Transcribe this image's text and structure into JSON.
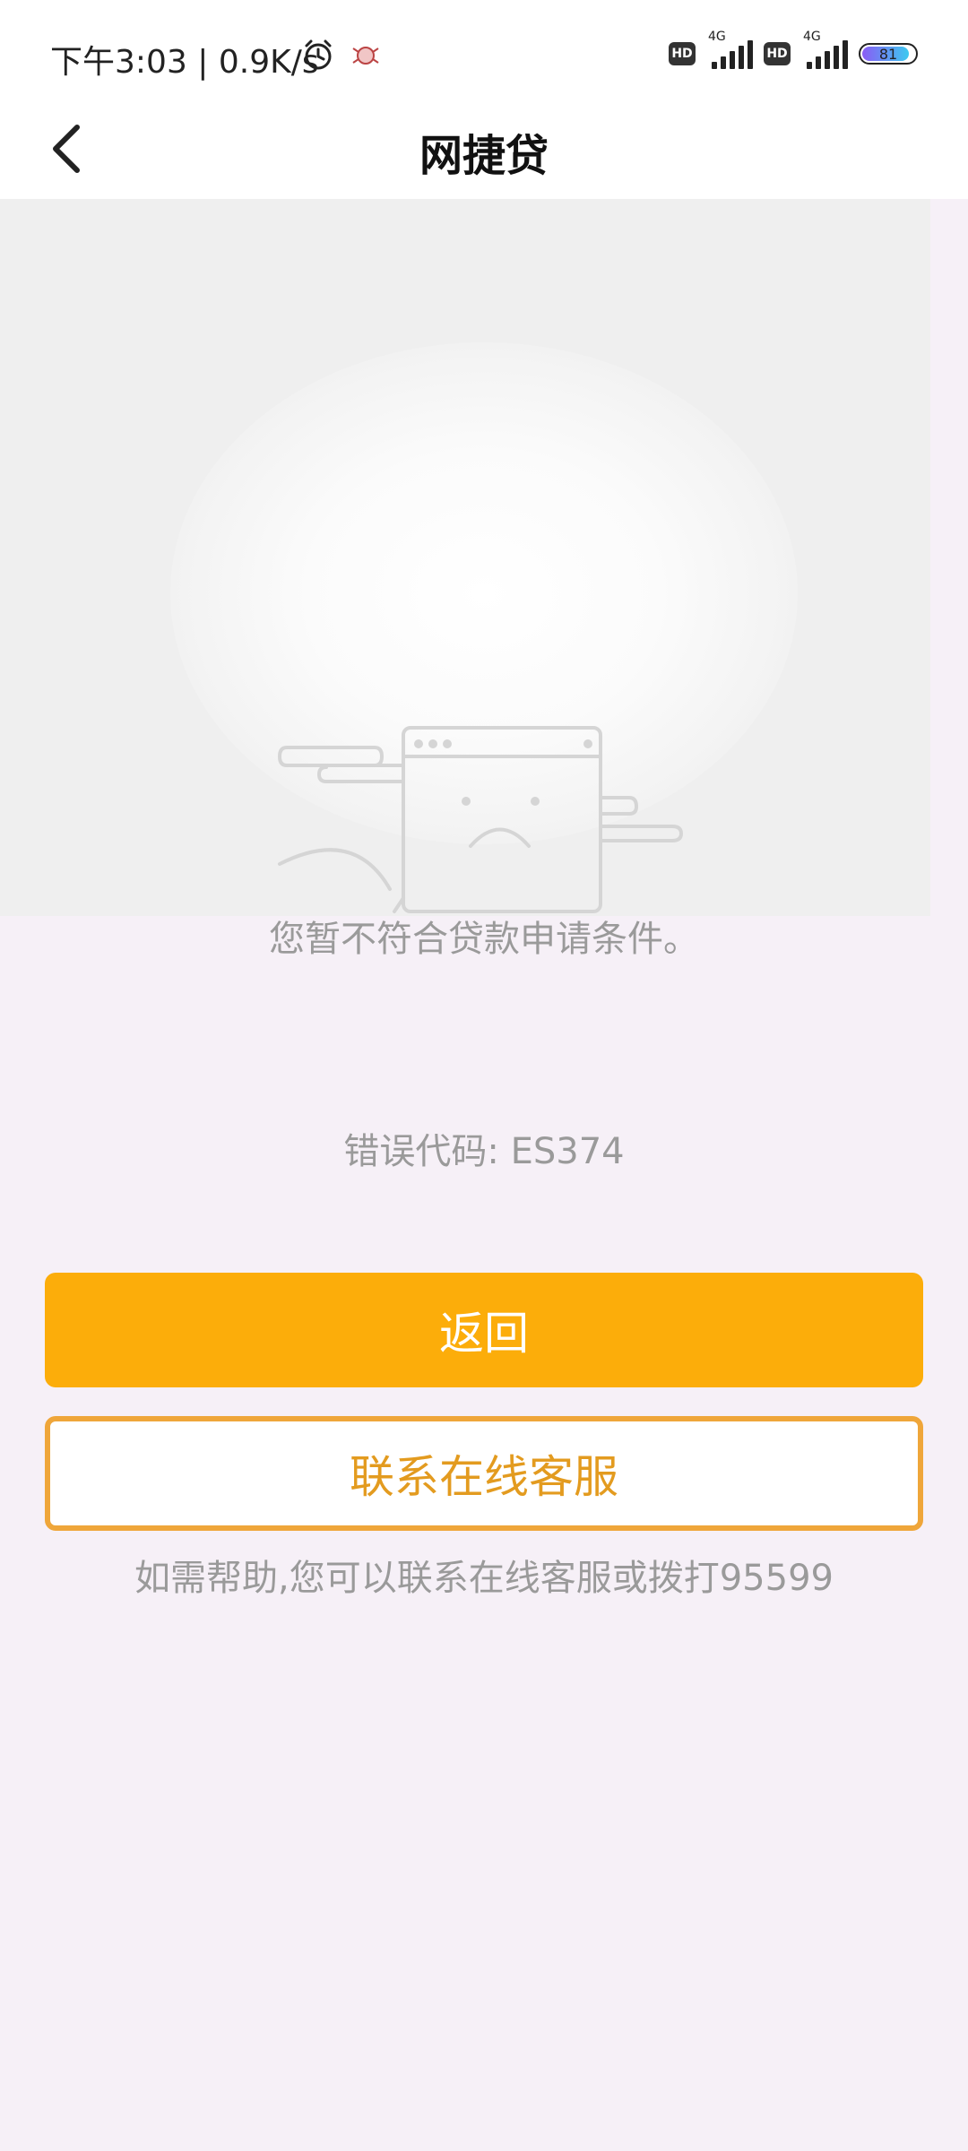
{
  "status_bar": {
    "time_speed": "下午3:03 | 0.9K/s",
    "hd_label": "HD",
    "network_type": "4G",
    "battery_level": "81",
    "icons": [
      "alarm-icon",
      "notification-app-icon",
      "hd-icon",
      "signal-icon",
      "battery-icon"
    ]
  },
  "header": {
    "title": "网捷贷",
    "back_icon": "chevron-left-icon"
  },
  "illustration": {
    "icon": "sad-browser-window-icon"
  },
  "content": {
    "message": "您暂不符合贷款申请条件。",
    "error_code": "错误代码: ES374"
  },
  "buttons": {
    "return_label": "返回",
    "service_label": "联系在线客服"
  },
  "help": {
    "text": "如需帮助,您可以联系在线客服或拨打95599"
  },
  "colors": {
    "primary": "#fcad0a",
    "outline": "#efa63a",
    "page_bg": "#f6f0f7",
    "muted_text": "#9a9a9a"
  }
}
